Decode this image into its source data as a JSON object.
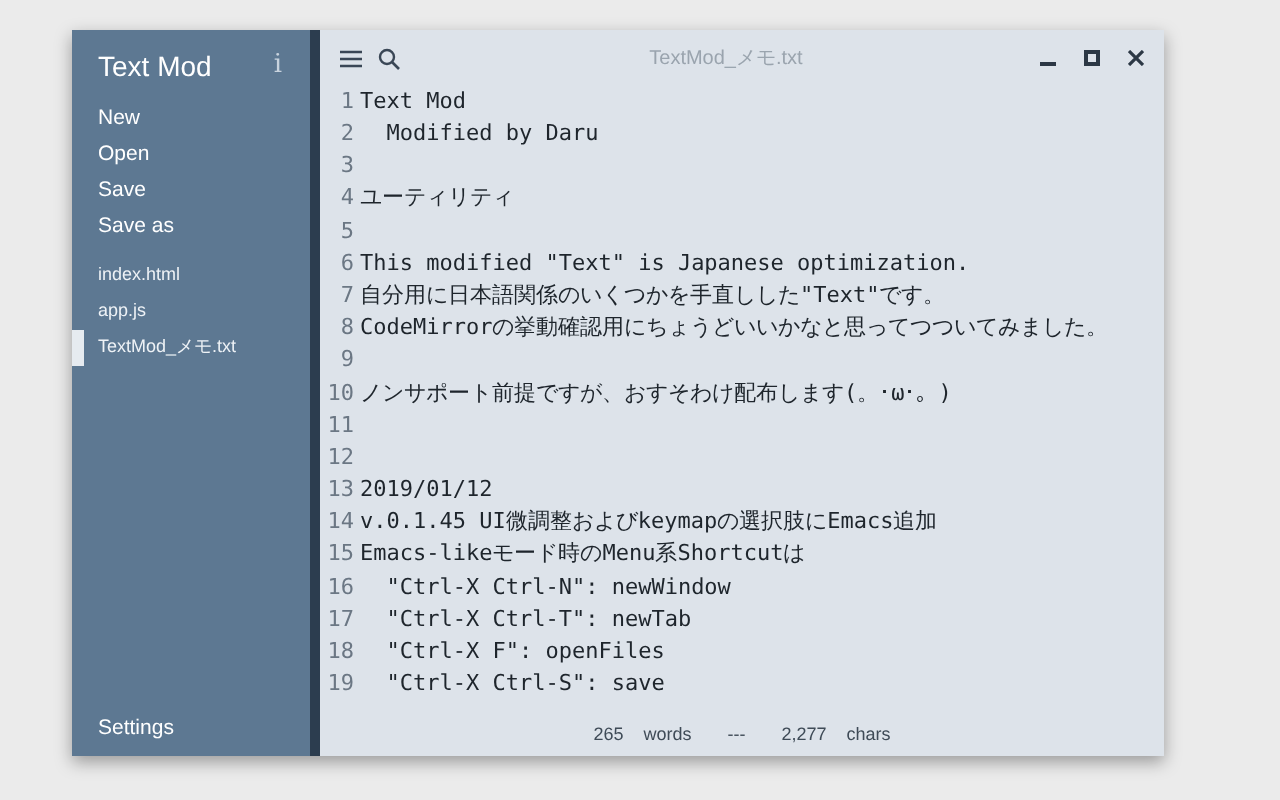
{
  "sidebar": {
    "title": "Text Mod",
    "info": "i",
    "menu": [
      "New",
      "Open",
      "Save",
      "Save as"
    ],
    "files": [
      {
        "name": "index.html",
        "selected": false
      },
      {
        "name": "app.js",
        "selected": false
      },
      {
        "name": "TextMod_メモ.txt",
        "selected": true
      }
    ],
    "settings": "Settings"
  },
  "editor": {
    "title": "TextMod_メモ.txt",
    "lines": [
      {
        "number": "1",
        "text": "Text Mod"
      },
      {
        "number": "2",
        "text": "  Modified by Daru"
      },
      {
        "number": "3"
      },
      {
        "number": "4",
        "text": "ユーティリティ"
      },
      {
        "number": "5"
      },
      {
        "number": "6",
        "text": "This modified \"Text\" is Japanese optimization."
      },
      {
        "number": "7",
        "text": "自分用に日本語関係のいくつかを手直しした\"Text\"です。"
      },
      {
        "number": "8",
        "text": "CodeMirrorの挙動確認用にちょうどいいかなと思ってつついてみました。"
      },
      {
        "number": "9"
      },
      {
        "number": "10",
        "text": "ノンサポート前提ですが、おすそわけ配布します(。･ω･。)"
      },
      {
        "number": "11"
      },
      {
        "number": "12"
      },
      {
        "number": "13",
        "text": "2019/01/12"
      },
      {
        "number": "14",
        "text": "v.0.1.45 UI微調整およびkeymapの選択肢にEmacs追加"
      },
      {
        "number": "15",
        "text": "Emacs-likeモード時のMenu系Shortcutは"
      },
      {
        "number": "16",
        "text": "  \"Ctrl-X Ctrl-N\": newWindow"
      },
      {
        "number": "17",
        "text": "  \"Ctrl-X Ctrl-T\": newTab"
      },
      {
        "number": "18",
        "text": "  \"Ctrl-X F\": openFiles"
      },
      {
        "number": "19",
        "text": "  \"Ctrl-X Ctrl-S\": save"
      }
    ],
    "status": {
      "words": "265",
      "words_label": "words",
      "separator": "---",
      "chars": "2,277",
      "chars_label": "chars"
    }
  }
}
